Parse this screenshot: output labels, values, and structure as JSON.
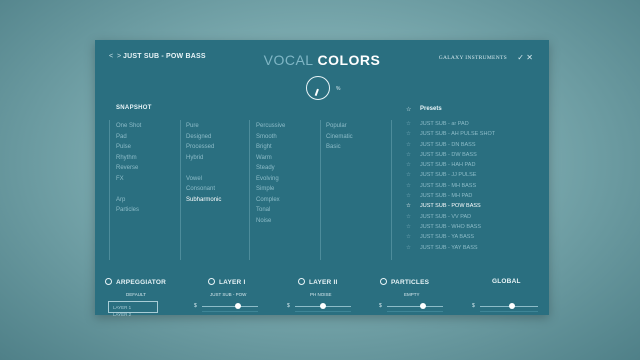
{
  "header": {
    "nav_icon": "chevron-left-right-icon",
    "nav": "< >",
    "preset_name": "JUST SUB - POW BASS",
    "title_part1": "VOCAL",
    "title_part2": "COLORS",
    "brand": "GALAXY INSTRUMENTS",
    "check": "✓",
    "close": "✕"
  },
  "knob": {
    "unit": "%"
  },
  "snapshot": {
    "title": "SNAPSHOT",
    "col1": [
      "One Shot",
      "Pad",
      "Pulse",
      "Rhythm",
      "Reverse",
      "FX",
      "",
      "Arp",
      "Particles"
    ],
    "col2": [
      "Pure",
      "Designed",
      "Processed",
      "Hybrid",
      "",
      "Vowel",
      "Consonant",
      "Subharmonic"
    ],
    "col3": [
      "Percussive",
      "Smooth",
      "Bright",
      "Warm",
      "Steady",
      "Evolving",
      "Simple",
      "Complex",
      "Tonal",
      "Noise"
    ],
    "col4": [
      "Popular",
      "Cinematic",
      "Basic"
    ],
    "selected": "Subharmonic"
  },
  "presets": {
    "title": "Presets",
    "items": [
      "JUST SUB - ar PAD",
      "JUST SUB - AH PULSE SHOT",
      "JUST SUB - DN BASS",
      "JUST SUB - DW BASS",
      "JUST SUB - HAH PAD",
      "JUST SUB - JJ PULSE",
      "JUST SUB - MH BASS",
      "JUST SUB - MH PAD",
      "JUST SUB - POW BASS",
      "JUST SUB - VV PAD",
      "JUST SUB - WHO BASS",
      "JUST SUB - YA BASS",
      "JUST SUB - YAY BASS"
    ],
    "selected": "JUST SUB - POW BASS"
  },
  "footer": {
    "arpeggiator": {
      "label": "ARPEGGIATOR",
      "sub": "DEFAULT",
      "layer1": "LAYER 1",
      "layer2": "LAYER 2"
    },
    "layer1": {
      "label": "LAYER I",
      "sub": "JUST SUB - POW",
      "level": 0.65
    },
    "layer2": {
      "label": "LAYER II",
      "sub": "PH NOISE",
      "level": 0.5
    },
    "particles": {
      "label": "PARTICLES",
      "sub": "EMPTY",
      "level": 0.65
    },
    "global": {
      "label": "GLOBAL",
      "level": 0.55
    },
    "slider_marker": "$"
  },
  "colors": {
    "panel": "#2a6f80",
    "accent": "#ffffff"
  }
}
